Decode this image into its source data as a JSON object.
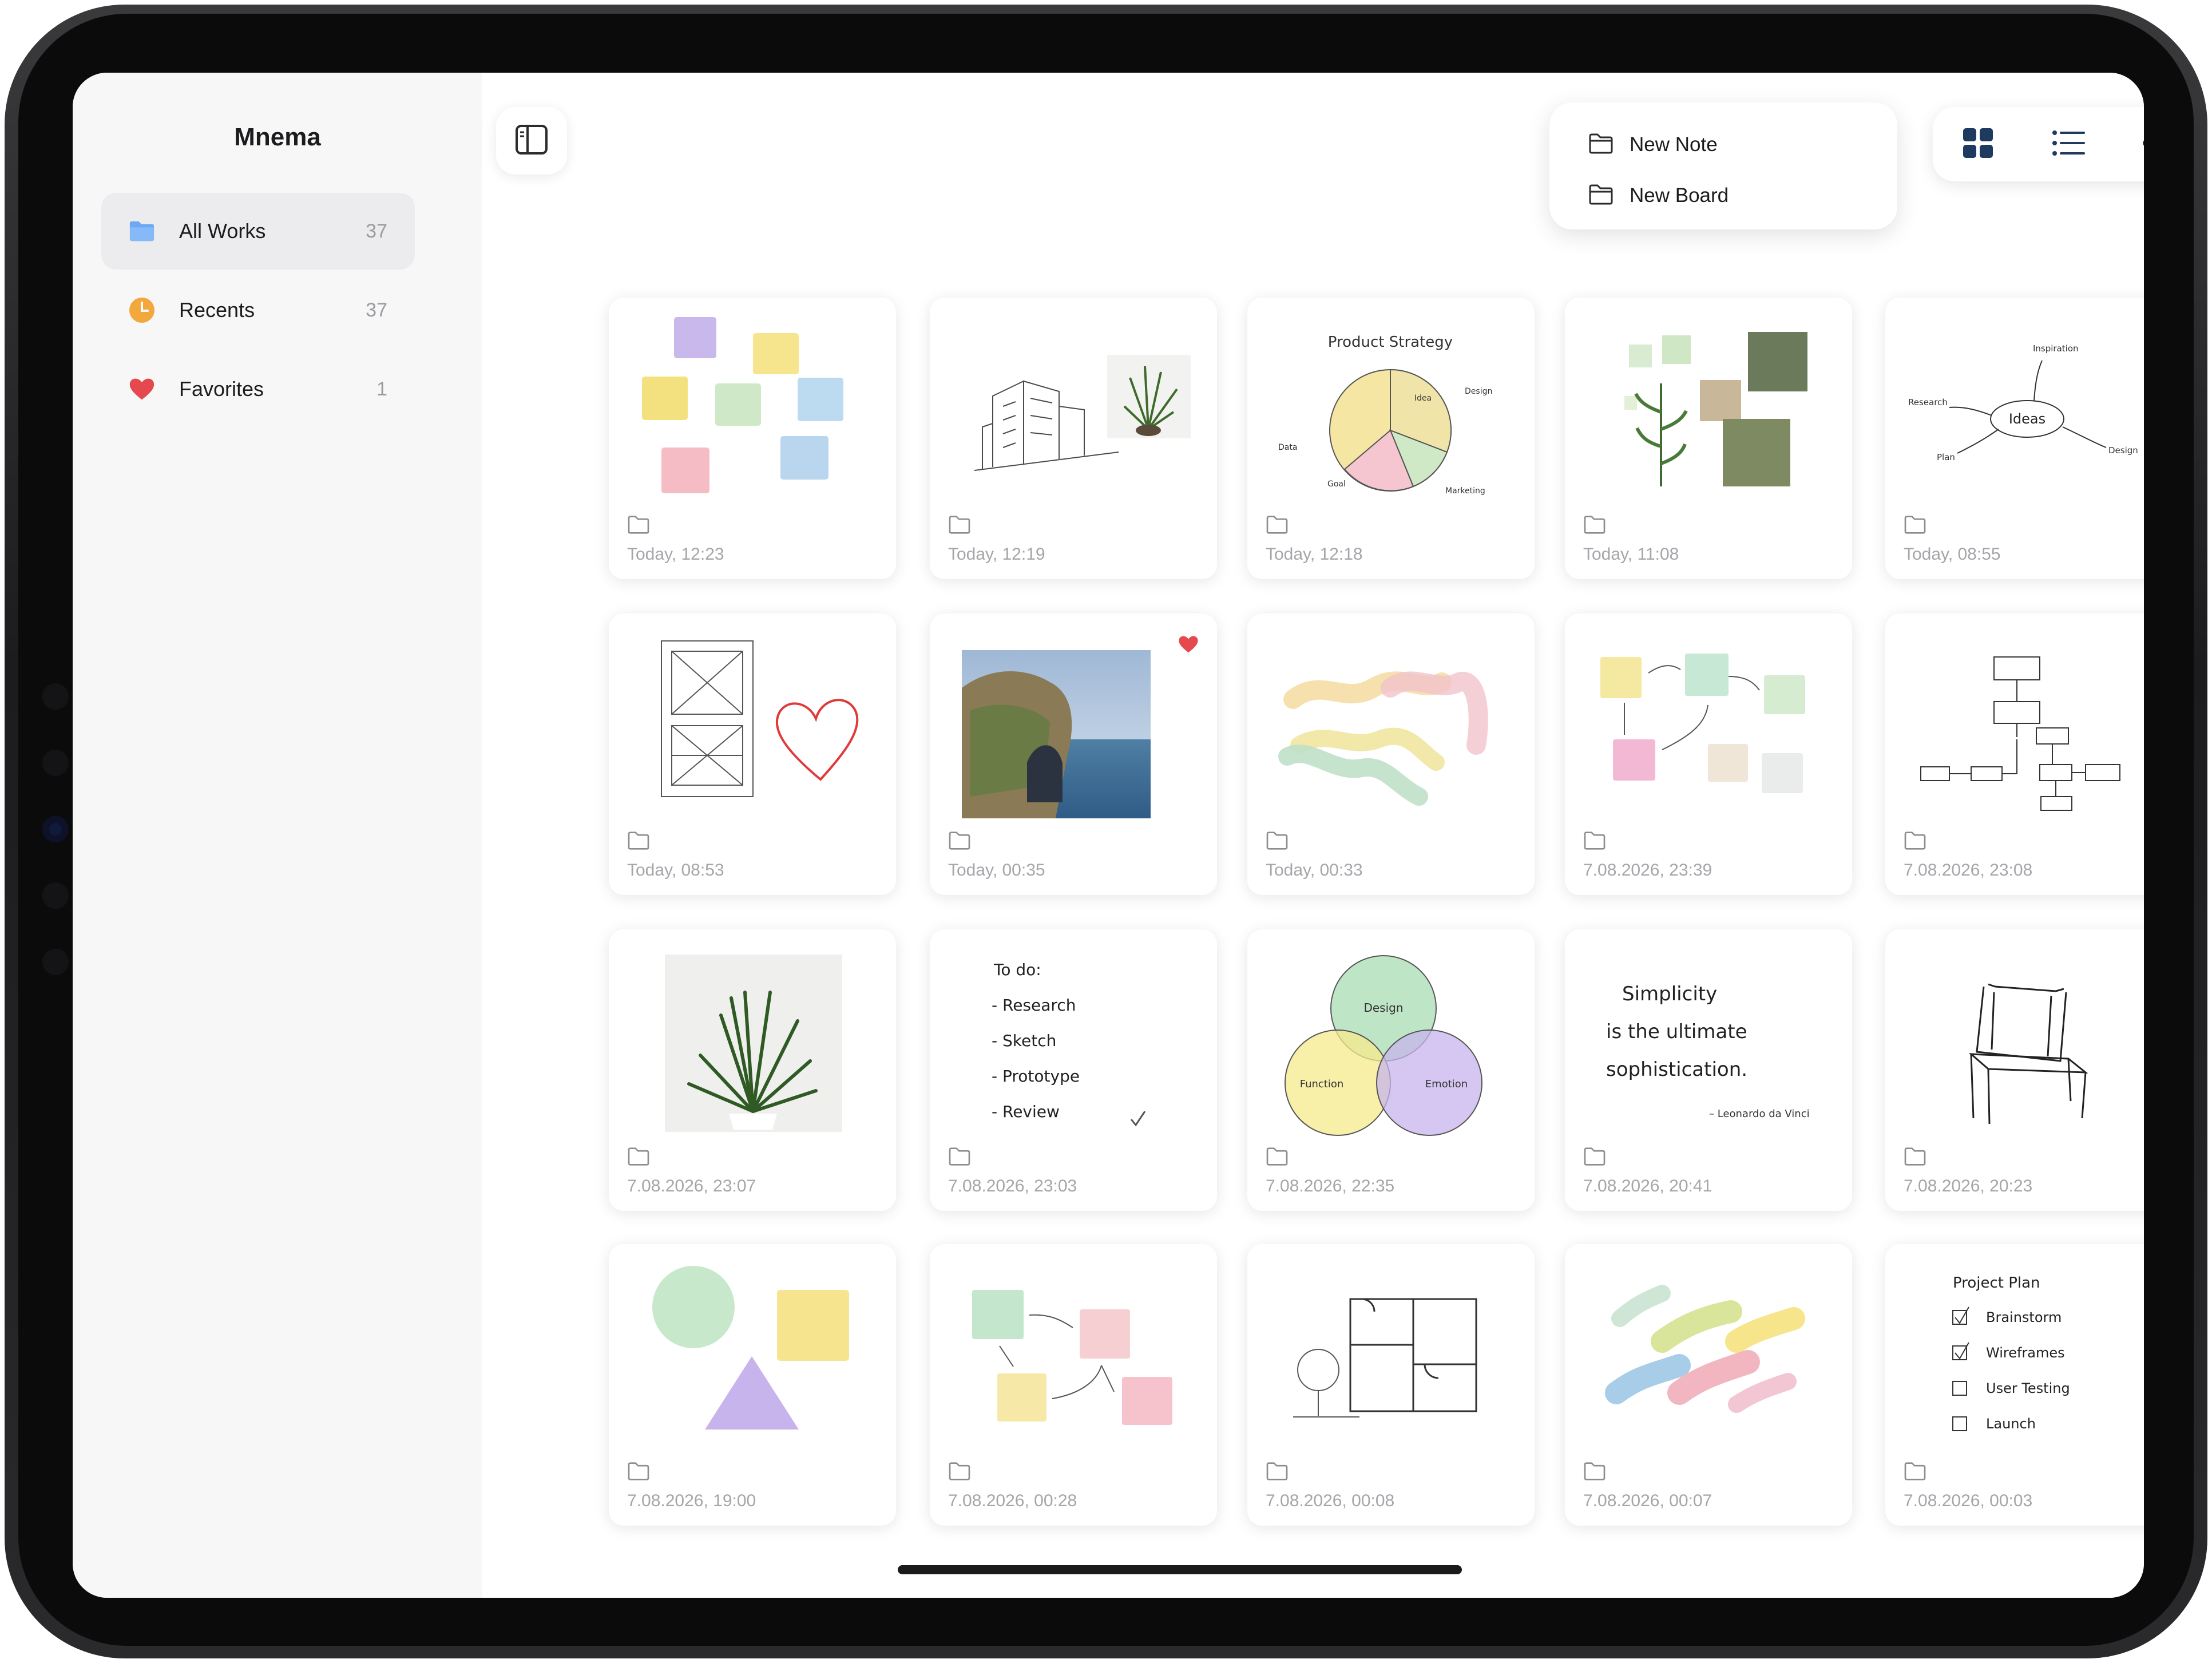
{
  "app": {
    "title": "Mnema"
  },
  "sidebar": {
    "items": [
      {
        "label": "All Works",
        "count": "37",
        "icon": "folder-icon",
        "active": true
      },
      {
        "label": "Recents",
        "count": "37",
        "icon": "clock-icon",
        "active": false
      },
      {
        "label": "Favorites",
        "count": "1",
        "icon": "heart-icon",
        "active": false
      }
    ]
  },
  "toolbar": {
    "new_menu": {
      "items": [
        "New Note",
        "New Board"
      ]
    },
    "view_modes": [
      "grid-view-icon",
      "list-view-icon",
      "more-icon"
    ],
    "active_view": "grid"
  },
  "colors": {
    "accent_blue": "#6ba9f5",
    "recents_orange": "#f2a83c",
    "favorite_red": "#e5484d",
    "date_gray": "#a5a5aa"
  },
  "cards": [
    {
      "date": "Today, 12:23",
      "thumb": "sticky-notes"
    },
    {
      "date": "Today, 12:19",
      "thumb": "building-sketch-plant"
    },
    {
      "date": "Today, 12:18",
      "thumb": "product-strategy-pie",
      "texts": [
        "Product Strategy",
        "Idea",
        "Design",
        "Data",
        "Goal",
        "Marketing"
      ]
    },
    {
      "date": "Today, 11:08",
      "thumb": "plant-moodboard"
    },
    {
      "date": "Today, 08:55",
      "thumb": "ideas-mindmap",
      "texts": [
        "Ideas",
        "Inspiration",
        "Research",
        "Plan",
        "Design"
      ]
    },
    {
      "date": "Today, 08:53",
      "thumb": "wireframe-heart"
    },
    {
      "date": "Today, 00:35",
      "thumb": "coastal-photo",
      "favorite": true
    },
    {
      "date": "Today, 00:33",
      "thumb": "pastel-waves"
    },
    {
      "date": "7.08.2026, 23:39",
      "thumb": "sticky-flow"
    },
    {
      "date": "7.08.2026, 23:08",
      "thumb": "flowchart"
    },
    {
      "date": "7.08.2026, 23:07",
      "thumb": "plant-photo"
    },
    {
      "date": "7.08.2026, 23:03",
      "thumb": "todo-list",
      "texts": [
        "To do:",
        "- Research",
        "- Sketch",
        "- Prototype",
        "- Review"
      ]
    },
    {
      "date": "7.08.2026, 22:35",
      "thumb": "venn-diagram",
      "texts": [
        "Design",
        "Function",
        "Emotion"
      ]
    },
    {
      "date": "7.08.2026, 20:41",
      "thumb": "quote",
      "texts": [
        "Simplicity",
        "is the ultimate",
        "sophistication.",
        "– Leonardo da Vinci"
      ]
    },
    {
      "date": "7.08.2026, 20:23",
      "thumb": "chair-sketch"
    },
    {
      "date": "7.08.2026, 19:00",
      "thumb": "shapes"
    },
    {
      "date": "7.08.2026, 00:28",
      "thumb": "sticky-arrows"
    },
    {
      "date": "7.08.2026, 00:08",
      "thumb": "floor-plan"
    },
    {
      "date": "7.08.2026, 00:07",
      "thumb": "color-swatches"
    },
    {
      "date": "7.08.2026, 00:03",
      "thumb": "project-plan",
      "texts": [
        "Project Plan",
        "Brainstorm",
        "Wireframes",
        "User Testing",
        "Launch"
      ]
    }
  ]
}
